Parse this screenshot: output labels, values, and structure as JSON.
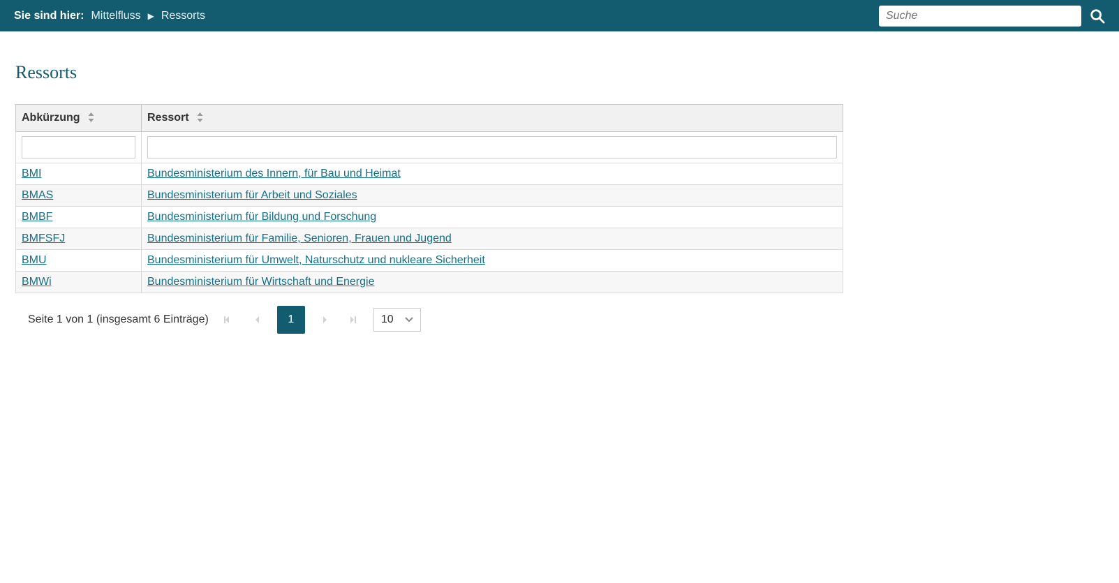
{
  "topbar": {
    "breadcrumb_label": "Sie sind hier:",
    "items": [
      "Mittelfluss",
      "Ressorts"
    ],
    "search_placeholder": "Suche"
  },
  "page": {
    "title": "Ressorts"
  },
  "table": {
    "columns": [
      {
        "label": "Abkürzung"
      },
      {
        "label": "Ressort"
      }
    ],
    "rows": [
      {
        "abbr": "BMI",
        "name": "Bundesministerium des Innern, für Bau und Heimat"
      },
      {
        "abbr": "BMAS",
        "name": "Bundesministerium für Arbeit und Soziales"
      },
      {
        "abbr": "BMBF",
        "name": "Bundesministerium für Bildung und Forschung"
      },
      {
        "abbr": "BMFSFJ",
        "name": "Bundesministerium für Familie, Senioren, Frauen und Jugend"
      },
      {
        "abbr": "BMU",
        "name": "Bundesministerium für Umwelt, Naturschutz und nukleare Sicherheit"
      },
      {
        "abbr": "BMWi",
        "name": "Bundesministerium für Wirtschaft und Energie"
      }
    ]
  },
  "pagination": {
    "summary": "Seite 1 von 1 (insgesamt 6 Einträge)",
    "current_page": "1",
    "page_size": "10"
  }
}
